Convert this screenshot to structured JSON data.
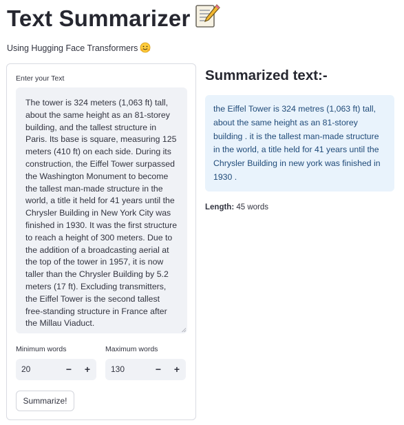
{
  "header": {
    "title": "Text Summarizer",
    "title_icon": "memo-icon",
    "subtitle": "Using Hugging Face Transformers",
    "subtitle_icon": "hugging-face-icon"
  },
  "form": {
    "text_label": "Enter your Text",
    "text_value": "The tower is 324 meters (1,063 ft) tall, about the same height as an 81-storey building, and the tallest structure in Paris. Its base is square, measuring 125 meters (410 ft) on each side. During its construction, the Eiffel Tower surpassed the Washington Monument to become the tallest man-made structure in the world, a title it held for 41 years until the Chrysler Building in New York City was finished in 1930. It was the first structure to reach a height of 300 meters. Due to the addition of a broadcasting aerial at the top of the tower in 1957, it is now taller than the Chrysler Building by 5.2 meters (17 ft). Excluding transmitters, the Eiffel Tower is the second tallest free-standing structure in France after the Millau Viaduct.",
    "min_label": "Minimum words",
    "min_value": "20",
    "max_label": "Maximum words",
    "max_value": "130",
    "minus_symbol": "−",
    "plus_symbol": "+",
    "submit_label": "Summarize!"
  },
  "result": {
    "title": "Summarized text:-",
    "text": "the Eiffel Tower is 324 metres (1,063 ft) tall, about the same height as an 81-storey building . it is the tallest man-made structure in the world, a title held for 41 years until the Chrysler Building in new york was finished in 1930 .",
    "length_label": "Length:",
    "length_value": "45 words"
  },
  "colors": {
    "input_bg": "#f0f2f6",
    "result_bg": "#e9f3fc",
    "result_text": "#1f4a78",
    "border": "#d9dbe2"
  }
}
